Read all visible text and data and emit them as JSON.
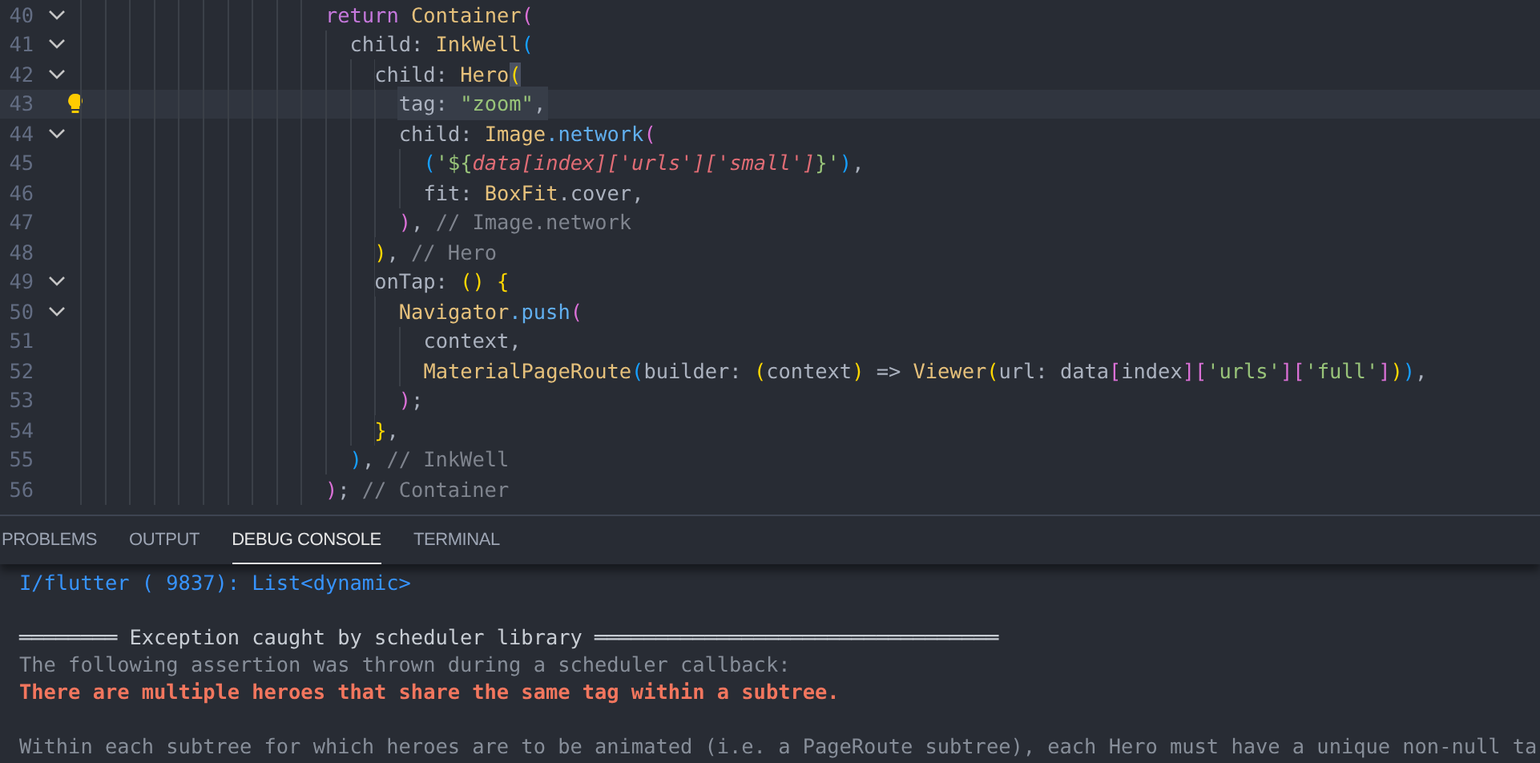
{
  "editor": {
    "lines": [
      {
        "number": "40",
        "foldable": true,
        "current": false,
        "lightbulb": false,
        "tokens": [
          {
            "kind": "k",
            "text": "                    return "
          },
          {
            "kind": "t",
            "text": "Container"
          },
          {
            "kind": "b2",
            "text": "("
          }
        ]
      },
      {
        "number": "41",
        "foldable": true,
        "current": false,
        "lightbulb": false,
        "tokens": [
          {
            "kind": "p",
            "text": "                      child: "
          },
          {
            "kind": "t",
            "text": "InkWell"
          },
          {
            "kind": "b3",
            "text": "("
          }
        ]
      },
      {
        "number": "42",
        "foldable": true,
        "current": false,
        "lightbulb": false,
        "tokens": [
          {
            "kind": "p",
            "text": "                        child: "
          },
          {
            "kind": "t",
            "text": "Hero"
          },
          {
            "kind": "m",
            "text": "("
          }
        ]
      },
      {
        "number": "43",
        "foldable": false,
        "current": true,
        "lightbulb": true,
        "tokens": [
          {
            "kind": "p",
            "text": "                          tag: "
          },
          {
            "kind": "s",
            "text": "\"zoom\""
          },
          {
            "kind": "p",
            "text": ","
          }
        ]
      },
      {
        "number": "44",
        "foldable": true,
        "current": false,
        "lightbulb": false,
        "tokens": [
          {
            "kind": "p",
            "text": "                          child: "
          },
          {
            "kind": "t",
            "text": "Image"
          },
          {
            "kind": "f",
            "text": ".network"
          },
          {
            "kind": "b2",
            "text": "("
          }
        ]
      },
      {
        "number": "45",
        "foldable": false,
        "current": false,
        "lightbulb": false,
        "tokens": [
          {
            "kind": "b3",
            "text": "                            ("
          },
          {
            "kind": "s",
            "text": "'${"
          },
          {
            "kind": "i",
            "text": "data[index]['urls']['small']"
          },
          {
            "kind": "s",
            "text": "}'"
          },
          {
            "kind": "b3",
            "text": ")"
          },
          {
            "kind": "p",
            "text": ","
          }
        ]
      },
      {
        "number": "46",
        "foldable": false,
        "current": false,
        "lightbulb": false,
        "tokens": [
          {
            "kind": "p",
            "text": "                            fit: "
          },
          {
            "kind": "t",
            "text": "BoxFit"
          },
          {
            "kind": "p",
            "text": ".cover,"
          }
        ]
      },
      {
        "number": "47",
        "foldable": false,
        "current": false,
        "lightbulb": false,
        "tokens": [
          {
            "kind": "b2",
            "text": "                          )"
          },
          {
            "kind": "p",
            "text": ", "
          },
          {
            "kind": "c",
            "text": "// Image.network"
          }
        ]
      },
      {
        "number": "48",
        "foldable": false,
        "current": false,
        "lightbulb": false,
        "tokens": [
          {
            "kind": "b1",
            "text": "                        )"
          },
          {
            "kind": "p",
            "text": ", "
          },
          {
            "kind": "c",
            "text": "// Hero"
          }
        ]
      },
      {
        "number": "49",
        "foldable": true,
        "current": false,
        "lightbulb": false,
        "tokens": [
          {
            "kind": "p",
            "text": "                        onTap: "
          },
          {
            "kind": "b1",
            "text": "() {"
          }
        ]
      },
      {
        "number": "50",
        "foldable": true,
        "current": false,
        "lightbulb": false,
        "tokens": [
          {
            "kind": "t",
            "text": "                          Navigator"
          },
          {
            "kind": "f",
            "text": ".push"
          },
          {
            "kind": "b2",
            "text": "("
          }
        ]
      },
      {
        "number": "51",
        "foldable": false,
        "current": false,
        "lightbulb": false,
        "tokens": [
          {
            "kind": "p",
            "text": "                            context,"
          }
        ]
      },
      {
        "number": "52",
        "foldable": false,
        "current": false,
        "lightbulb": false,
        "tokens": [
          {
            "kind": "t",
            "text": "                            MaterialPageRoute"
          },
          {
            "kind": "b3",
            "text": "("
          },
          {
            "kind": "p",
            "text": "builder: "
          },
          {
            "kind": "b1",
            "text": "("
          },
          {
            "kind": "p",
            "text": "context"
          },
          {
            "kind": "b1",
            "text": ")"
          },
          {
            "kind": "p",
            "text": " => "
          },
          {
            "kind": "t",
            "text": "Viewer"
          },
          {
            "kind": "b1",
            "text": "("
          },
          {
            "kind": "p",
            "text": "url: data"
          },
          {
            "kind": "b2",
            "text": "["
          },
          {
            "kind": "p",
            "text": "index"
          },
          {
            "kind": "b2",
            "text": "]["
          },
          {
            "kind": "s",
            "text": "'urls'"
          },
          {
            "kind": "b2",
            "text": "]["
          },
          {
            "kind": "s",
            "text": "'full'"
          },
          {
            "kind": "b2",
            "text": "]"
          },
          {
            "kind": "b1",
            "text": ")"
          },
          {
            "kind": "b3",
            "text": ")"
          },
          {
            "kind": "p",
            "text": ","
          }
        ]
      },
      {
        "number": "53",
        "foldable": false,
        "current": false,
        "lightbulb": false,
        "tokens": [
          {
            "kind": "b2",
            "text": "                          )"
          },
          {
            "kind": "p",
            "text": ";"
          }
        ]
      },
      {
        "number": "54",
        "foldable": false,
        "current": false,
        "lightbulb": false,
        "tokens": [
          {
            "kind": "b1",
            "text": "                        }"
          },
          {
            "kind": "p",
            "text": ","
          }
        ]
      },
      {
        "number": "55",
        "foldable": false,
        "current": false,
        "lightbulb": false,
        "tokens": [
          {
            "kind": "b3",
            "text": "                      )"
          },
          {
            "kind": "p",
            "text": ", "
          },
          {
            "kind": "c",
            "text": "// InkWell"
          }
        ]
      },
      {
        "number": "56",
        "foldable": false,
        "current": false,
        "lightbulb": false,
        "tokens": [
          {
            "kind": "b2",
            "text": "                    )"
          },
          {
            "kind": "p",
            "text": "; "
          },
          {
            "kind": "c",
            "text": "// Container"
          }
        ]
      }
    ]
  },
  "panel": {
    "tabs": [
      {
        "label": "PROBLEMS",
        "selected": false
      },
      {
        "label": "OUTPUT",
        "selected": false
      },
      {
        "label": "DEBUG CONSOLE",
        "selected": true
      },
      {
        "label": "TERMINAL",
        "selected": false
      }
    ],
    "console": [
      {
        "kind": "info",
        "gap_before": false,
        "text": "I/flutter ( 9837): List<dynamic>"
      },
      {
        "kind": "header",
        "gap_before": true,
        "text": "════════ Exception caught by scheduler library ═════════════════════════════════"
      },
      {
        "kind": "normal",
        "gap_before": false,
        "text": "The following assertion was thrown during a scheduler callback:"
      },
      {
        "kind": "error",
        "gap_before": false,
        "text": "There are multiple heroes that share the same tag within a subtree."
      },
      {
        "kind": "normal",
        "gap_before": true,
        "text": "Within each subtree for which heroes are to be animated (i.e. a PageRoute subtree), each Hero must have a unique non-null ta"
      }
    ]
  }
}
